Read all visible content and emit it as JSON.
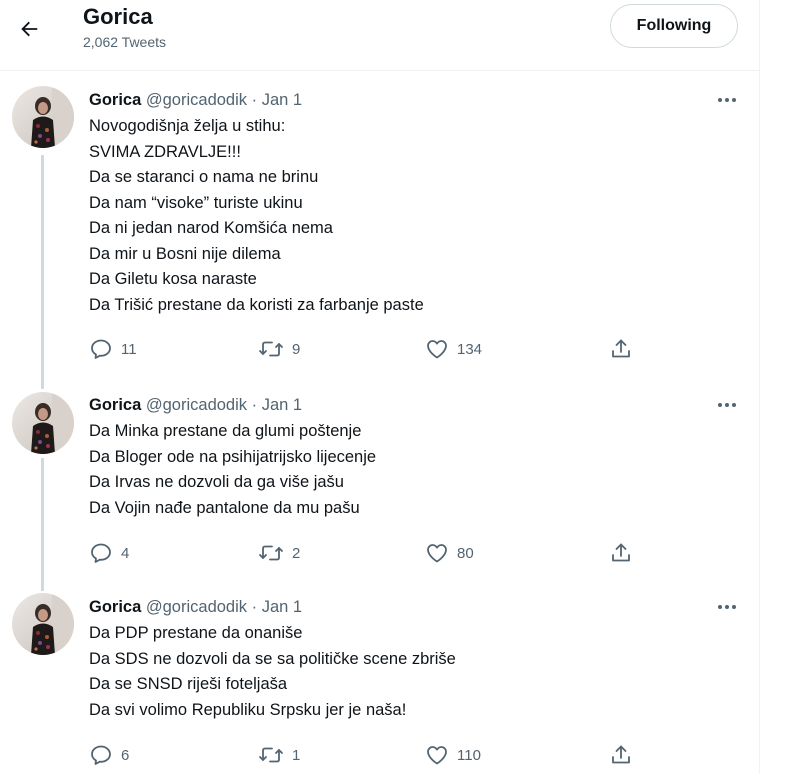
{
  "header": {
    "title": "Gorica",
    "tweet_count": "2,062 Tweets",
    "follow_label": "Following"
  },
  "colors": {
    "text": "#0f1419",
    "muted": "#536471",
    "border": "#cfd9de"
  },
  "icons": {
    "back": "arrow-left-icon",
    "more": "more-horizontal-icon",
    "reply": "reply-icon",
    "retweet": "retweet-icon",
    "like": "heart-icon",
    "share": "share-icon"
  },
  "tweets": [
    {
      "name": "Gorica",
      "handle": "@goricadodik",
      "dot": "·",
      "date": "Jan 1",
      "lines": [
        "Novogodišnja želja u stihu:",
        "SVIMA ZDRAVLJE!!!",
        "Da se staranci o nama ne brinu",
        "Da nam “visoke” turiste ukinu",
        "Da ni jedan narod Komšića nema",
        "Da mir u Bosni nije dilema",
        "Da Giletu kosa naraste",
        "Da Trišić prestane da koristi za farbanje paste"
      ],
      "replies": "11",
      "retweets": "9",
      "likes": "134"
    },
    {
      "name": "Gorica",
      "handle": "@goricadodik",
      "dot": "·",
      "date": "Jan 1",
      "lines": [
        "Da Minka prestane da glumi poštenje",
        "Da Bloger ode na psihijatrijsko lijecenje",
        "Da Irvas ne dozvoli da ga više jašu",
        "Da Vojin nađe pantalone da mu pašu"
      ],
      "replies": "4",
      "retweets": "2",
      "likes": "80"
    },
    {
      "name": "Gorica",
      "handle": "@goricadodik",
      "dot": "·",
      "date": "Jan 1",
      "lines": [
        "Da PDP prestane da onaniše",
        "Da SDS ne dozvoli da se sa političke scene zbriše",
        "Da se SNSD riješi foteljaša",
        "Da svi volimo Republiku Srpsku jer je naša!"
      ],
      "replies": "6",
      "retweets": "1",
      "likes": "110"
    }
  ]
}
